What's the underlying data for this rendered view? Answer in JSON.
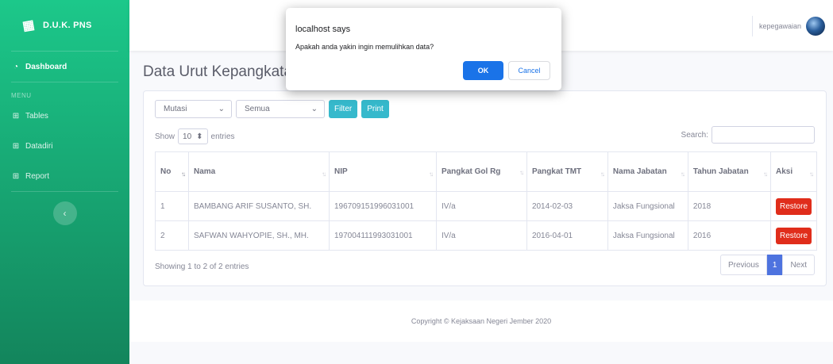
{
  "sidebar": {
    "brand": "D.U.K. PNS",
    "dashboard": "Dashboard",
    "heading": "MENU",
    "items": [
      "Tables",
      "Datadiri",
      "Report"
    ]
  },
  "topbar": {
    "user": "kepegawaian"
  },
  "page": {
    "title": "Data Urut Kepangkatan Kejaksaan Negeri Jember"
  },
  "filters": {
    "type": "Mutasi",
    "scope": "Semua",
    "filter_label": "Filter",
    "print_label": "Print"
  },
  "datatable": {
    "show_label": "Show",
    "length": "10",
    "entries_label": "entries",
    "search_label": "Search:",
    "columns": [
      "No",
      "Nama",
      "NIP",
      "Pangkat Gol Rg",
      "Pangkat TMT",
      "Nama Jabatan",
      "Tahun Jabatan",
      "Aksi"
    ],
    "rows": [
      [
        "1",
        "BAMBANG ARIF SUSANTO, SH.",
        "196709151996031001",
        "IV/a",
        "2014-02-03",
        "Jaksa Fungsional",
        "2018"
      ],
      [
        "2",
        "SAFWAN WAHYOPIE, SH., MH.",
        "197004111993031001",
        "IV/a",
        "2016-04-01",
        "Jaksa Fungsional",
        "2016"
      ]
    ],
    "action_label": "Restore",
    "info": "Showing 1 to 2 of 2 entries",
    "pagination": {
      "previous": "Previous",
      "current": "1",
      "next": "Next"
    }
  },
  "footer": {
    "copyright": "Copyright © Kejaksaan Negeri Jember 2020"
  },
  "dialog": {
    "title": "localhost says",
    "message": "Apakah anda yakin ingin memulihkan data?",
    "ok": "OK",
    "cancel": "Cancel"
  },
  "colors": {
    "sidebar_top": "#1cc88a",
    "sidebar_bottom": "#13855c",
    "info": "#36b9cc",
    "danger": "#e02d1b",
    "primary": "#4e73df",
    "dialog_ok": "#1a73e8"
  }
}
